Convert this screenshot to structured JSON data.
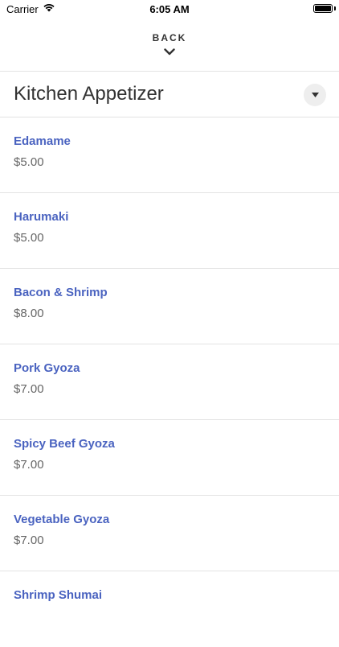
{
  "status_bar": {
    "carrier": "Carrier",
    "time": "6:05 AM"
  },
  "nav": {
    "back_label": "BACK"
  },
  "category": {
    "title": "Kitchen Appetizer"
  },
  "colors": {
    "item_name": "#4a63c0",
    "price": "#666666",
    "divider": "#e3e3e3"
  },
  "items": [
    {
      "name": "Edamame",
      "price": "$5.00"
    },
    {
      "name": "Harumaki",
      "price": "$5.00"
    },
    {
      "name": "Bacon & Shrimp",
      "price": "$8.00"
    },
    {
      "name": "Pork Gyoza",
      "price": "$7.00"
    },
    {
      "name": "Spicy Beef Gyoza",
      "price": "$7.00"
    },
    {
      "name": "Vegetable Gyoza",
      "price": "$7.00"
    },
    {
      "name": "Shrimp Shumai",
      "price": ""
    }
  ]
}
